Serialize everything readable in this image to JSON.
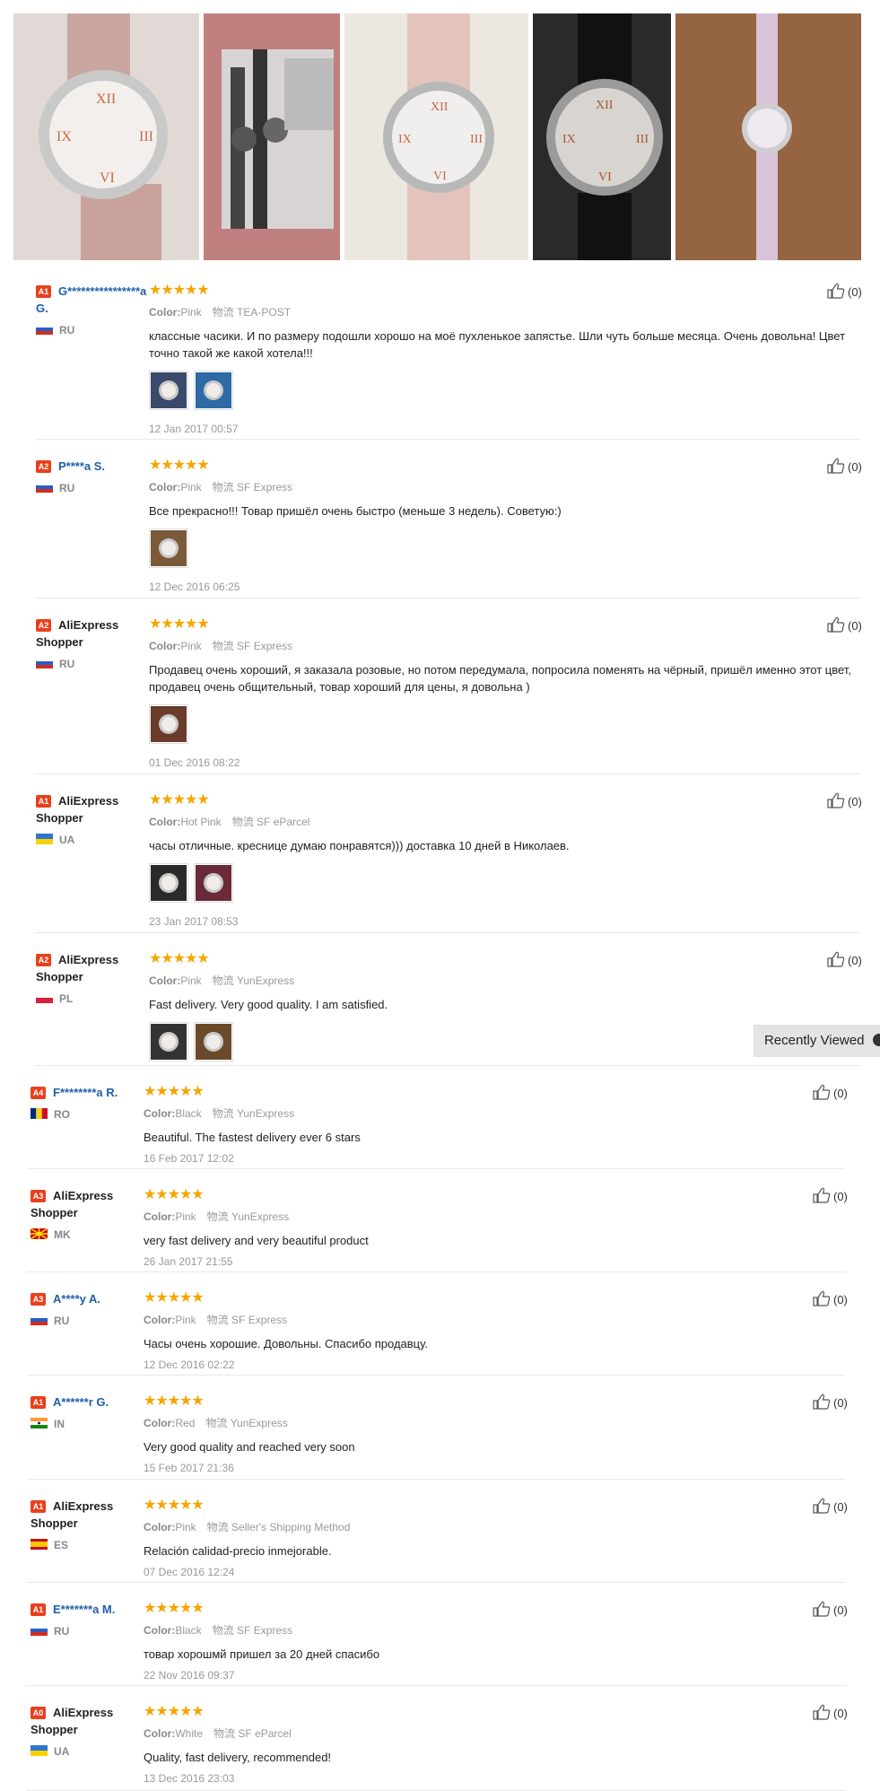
{
  "gallery": [
    {
      "name": "photo-watch-pink-bag"
    },
    {
      "name": "photo-watches-packaged"
    },
    {
      "name": "photo-watch-pink-bed"
    },
    {
      "name": "photo-watch-black"
    },
    {
      "name": "photo-watch-lilac-table"
    }
  ],
  "labels": {
    "color": "Color:",
    "shipping": "物流"
  },
  "colors": {
    "accent": "#e8401d",
    "star": "#f5a500",
    "link": "#1f5fa8"
  },
  "reviews": [
    {
      "level": "A1",
      "name": "G****************a G.",
      "country": "RU",
      "color": "Pink",
      "shipping": "TEA-POST",
      "text": "классные часики. И по размеру подошли хорошо на моё пухленькое запястье. Шли чуть больше месяца. Очень довольна! Цвет точно такой же какой хотела!!!",
      "date": "12 Jan 2017 00:57",
      "likes": "(0)"
    },
    {
      "level": "A2",
      "name": "P****a S.",
      "country": "RU",
      "color": "Pink",
      "shipping": "SF Express",
      "text": "Все прекрасно!!! Товар пришёл очень быстро (меньше 3 недель). Советую:)",
      "date": "12 Dec 2016 06:25",
      "likes": "(0)"
    },
    {
      "level": "A2",
      "name": "AliExpress Shopper",
      "country": "RU",
      "color": "Pink",
      "shipping": "SF Express",
      "text": "Продавец очень хороший, я заказала розовые, но потом передумала, попросила поменять на чёрный, пришёл именно этот цвет, продавец очень общительный, товар хороший для цены, я довольна )",
      "date": "01 Dec 2016 08:22",
      "likes": "(0)"
    },
    {
      "level": "A1",
      "name": "AliExpress Shopper",
      "country": "UA",
      "color": "Hot Pink",
      "shipping": "SF eParcel",
      "text": "часы отличные. креснице думаю понравятся))) доставка 10 дней в Николаев.",
      "date": "23 Jan 2017 08:53",
      "likes": "(0)"
    },
    {
      "level": "A2",
      "name": "AliExpress Shopper",
      "country": "PL",
      "color": "Pink",
      "shipping": "YunExpress",
      "text": "Fast delivery. Very good quality. I am satisfied.",
      "date": "",
      "likes": "(0)"
    },
    {
      "level": "A4",
      "name": "F********a R.",
      "country": "RO",
      "color": "Black",
      "shipping": "YunExpress",
      "text": "Beautiful. The fastest delivery ever 6 stars",
      "date": "16 Feb 2017 12:02",
      "likes": "(0)"
    },
    {
      "level": "A3",
      "name": "AliExpress Shopper",
      "country": "MK",
      "color": "Pink",
      "shipping": "YunExpress",
      "text": "very fast delivery and very beautiful product",
      "date": "26 Jan 2017 21:55",
      "likes": "(0)"
    },
    {
      "level": "A3",
      "name": "A****y A.",
      "country": "RU",
      "color": "Pink",
      "shipping": "SF Express",
      "text": "Часы очень хорошие. Довольны. Спасибо продавцу.",
      "date": "12 Dec 2016 02:22",
      "likes": "(0)"
    },
    {
      "level": "A1",
      "name": "A******r G.",
      "country": "IN",
      "color": "Red",
      "shipping": "YunExpress",
      "text": "Very good quality and reached very soon",
      "date": "15 Feb 2017 21:36",
      "likes": "(0)"
    },
    {
      "level": "A1",
      "name": "AliExpress Shopper",
      "country": "ES",
      "color": "Pink",
      "shipping": "Seller's Shipping Method",
      "text": "Relación calidad-precio inmejorable.",
      "date": "07 Dec 2016 12:24",
      "likes": "(0)"
    },
    {
      "level": "A1",
      "name": "E*******a M.",
      "country": "RU",
      "color": "Black",
      "shipping": "SF Express",
      "text": "товар хорошмй пришел за 20 дней спасибо",
      "date": "22 Nov 2016 09:37",
      "likes": "(0)"
    },
    {
      "level": "A0",
      "name": "AliExpress Shopper",
      "country": "UA",
      "color": "White",
      "shipping": "SF eParcel",
      "text": "Quality, fast delivery, recommended!",
      "date": "13 Dec 2016 23:03",
      "likes": "(0)"
    }
  ],
  "recently_viewed": "Recently Viewed"
}
